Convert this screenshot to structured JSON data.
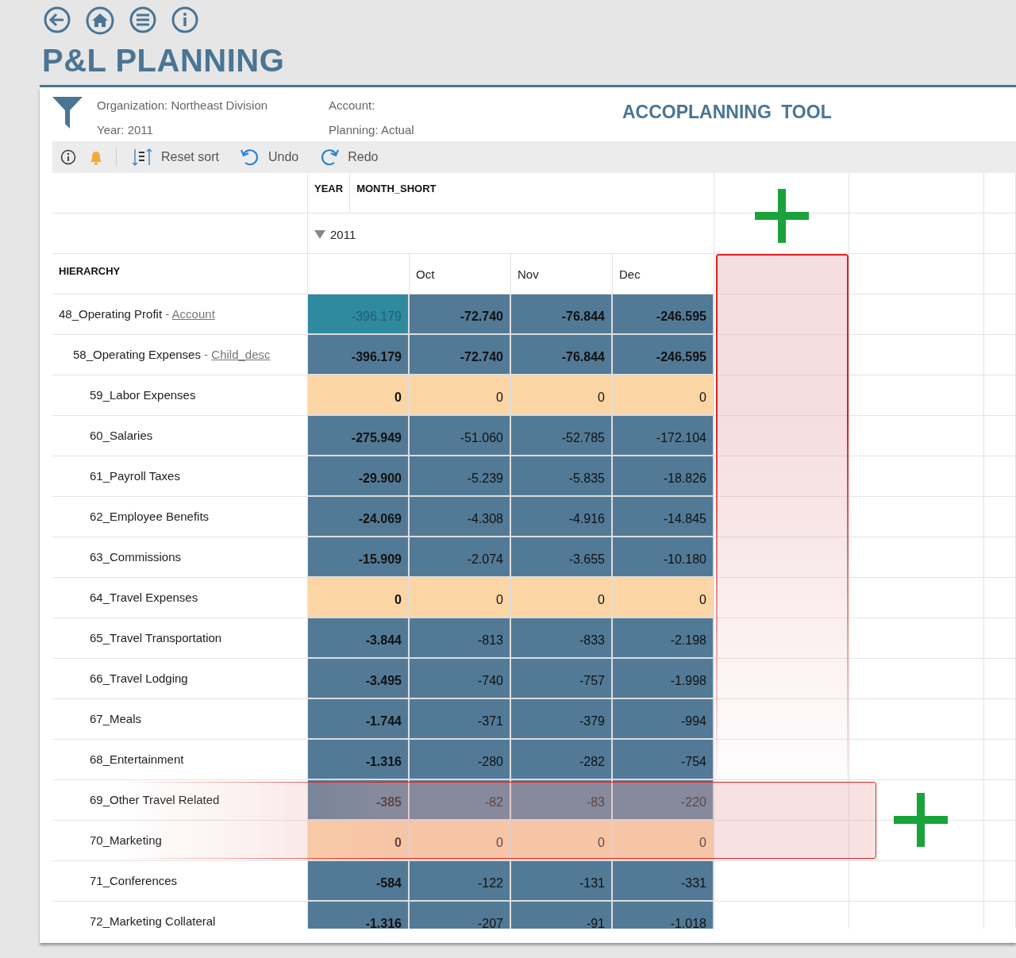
{
  "title": "P&L PLANNING",
  "filters": [
    "Organization: Northeast Division",
    "Account:",
    "Year: 2011",
    "Planning: Actual"
  ],
  "tool_name": "ACCOPLANNING TOOL",
  "toolbar": [
    {
      "kind": "reset-sort",
      "label": "Reset sort"
    },
    {
      "kind": "undo",
      "label": "Undo"
    },
    {
      "kind": "redo",
      "label": "Redo"
    }
  ],
  "pivot": {
    "column_fields": [
      "YEAR",
      "MONTH_SHORT"
    ],
    "year": "2011",
    "expanded": true,
    "row_field": "HIERARCHY",
    "months": [
      "Oct",
      "Nov",
      "Dec"
    ],
    "rows": [
      {
        "label": "48_Operating Profit",
        "separator": "-",
        "link": "Account",
        "kind": "group",
        "selected": true,
        "values": [
          "-396.179",
          "-72.740",
          "-76.844",
          "-246.595"
        ],
        "children": [
          {
            "label": "58_Operating Expenses",
            "separator": "-",
            "link": "Child_desc",
            "kind": "group",
            "selected": false,
            "values": [
              "-396.179",
              "-72.740",
              "-76.844",
              "-246.595"
            ],
            "children": [
              {
                "label": "59_Labor Expenses",
                "kind": "zero",
                "selected": false,
                "values": [
                  "0",
                  "0",
                  "0",
                  "0"
                ]
              },
              {
                "label": "60_Salaries",
                "kind": "detail",
                "selected": false,
                "values": [
                  "-275.949",
                  "-51.060",
                  "-52.785",
                  "-172.104"
                ]
              },
              {
                "label": "61_Payroll Taxes",
                "kind": "detail",
                "selected": false,
                "values": [
                  "-29.900",
                  "-5.239",
                  "-5.835",
                  "-18.826"
                ]
              },
              {
                "label": "62_Employee Benefits",
                "kind": "detail",
                "selected": false,
                "values": [
                  "-24.069",
                  "-4.308",
                  "-4.916",
                  "-14.845"
                ]
              },
              {
                "label": "63_Commissions",
                "kind": "detail",
                "selected": false,
                "values": [
                  "-15.909",
                  "-2.074",
                  "-3.655",
                  "-10.180"
                ]
              },
              {
                "label": "64_Travel Expenses",
                "kind": "zero",
                "selected": false,
                "values": [
                  "0",
                  "0",
                  "0",
                  "0"
                ]
              },
              {
                "label": "65_Travel Transportation",
                "kind": "detail",
                "selected": false,
                "values": [
                  "-3.844",
                  "-813",
                  "-833",
                  "-2.198"
                ]
              },
              {
                "label": "66_Travel Lodging",
                "kind": "detail",
                "selected": false,
                "values": [
                  "-3.495",
                  "-740",
                  "-757",
                  "-1.998"
                ]
              },
              {
                "label": "67_Meals",
                "kind": "detail",
                "selected": false,
                "values": [
                  "-1.744",
                  "-371",
                  "-379",
                  "-994"
                ]
              },
              {
                "label": "68_Entertainment",
                "kind": "detail",
                "selected": false,
                "values": [
                  "-1.316",
                  "-280",
                  "-282",
                  "-754"
                ]
              },
              {
                "label": "69_Other Travel Related",
                "kind": "detail",
                "selected": false,
                "values": [
                  "-385",
                  "-82",
                  "-83",
                  "-220"
                ]
              },
              {
                "label": "70_Marketing",
                "kind": "zero",
                "selected": false,
                "values": [
                  "0",
                  "0",
                  "0",
                  "0"
                ]
              },
              {
                "label": "71_Conferences",
                "kind": "detail",
                "selected": false,
                "values": [
                  "-584",
                  "-122",
                  "-131",
                  "-331"
                ]
              },
              {
                "label": "72_Marketing Collateral",
                "kind": "detail",
                "selected": false,
                "values": [
                  "-1.316",
                  "-207",
                  "-91",
                  "-1.018"
                ]
              }
            ]
          }
        ]
      }
    ]
  }
}
